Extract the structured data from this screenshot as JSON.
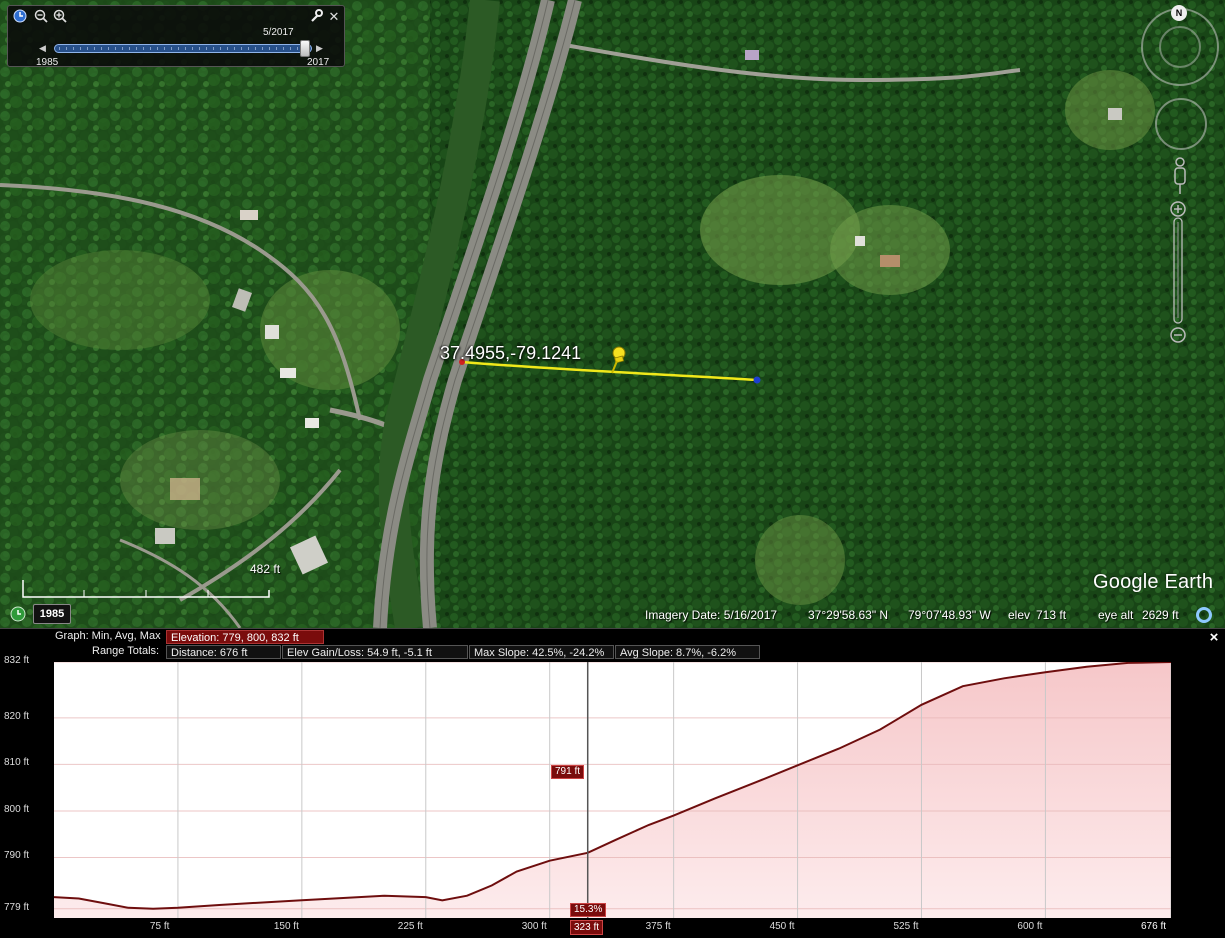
{
  "map": {
    "coord_label": "37.4955,-79.1241",
    "scale_label": "482 ft",
    "logo_text": "Google Earth",
    "imagery_year": "1985",
    "north_label": "N"
  },
  "time_slider": {
    "current_date": "5/2017",
    "start_year": "1985",
    "end_year": "2017",
    "position_fraction": 1.0
  },
  "status": {
    "imagery_date": "Imagery Date: 5/16/2017",
    "latitude": "37°29'58.63\" N",
    "longitude": "79°07'48.93\" W",
    "elev_label": "elev",
    "elev_value": "713 ft",
    "eye_alt_label": "eye alt",
    "eye_alt_value": "2629 ft"
  },
  "profile": {
    "graph_label": "Graph: Min, Avg, Max",
    "elevation_summary": "Elevation: 779, 800, 832 ft",
    "range_totals_label": "Range Totals:",
    "distance": "Distance: 676 ft",
    "elev_gain_loss": "Elev Gain/Loss: 54.9 ft, -5.1 ft",
    "max_slope": "Max Slope: 42.5%, -24.2%",
    "avg_slope": "Avg Slope: 8.7%, -6.2%",
    "cursor_elevation": "791 ft",
    "cursor_slope": "15.3%",
    "cursor_distance": "323 ft",
    "close_glyph": "×"
  },
  "chart_data": {
    "type": "area",
    "y_tick_labels": [
      "832 ft",
      "820 ft",
      "810 ft",
      "800 ft",
      "790 ft",
      "779 ft"
    ],
    "y_ticks": [
      832,
      820,
      810,
      800,
      790,
      779
    ],
    "x_tick_labels": [
      "75 ft",
      "150 ft",
      "225 ft",
      "300 ft",
      "375 ft",
      "450 ft",
      "525 ft",
      "600 ft",
      "676 ft"
    ],
    "x_ticks": [
      75,
      150,
      225,
      300,
      375,
      450,
      525,
      600,
      676
    ],
    "xlim": [
      0,
      676
    ],
    "ylim": [
      777,
      832
    ],
    "cursor_x": 323,
    "series": [
      {
        "x": [
          0,
          15,
          30,
          45,
          60,
          75,
          100,
          125,
          150,
          175,
          200,
          225,
          235,
          250,
          265,
          280,
          300,
          323,
          340,
          360,
          375,
          400,
          425,
          450,
          475,
          500,
          525,
          550,
          575,
          600,
          625,
          650,
          676
        ],
        "y": [
          781.5,
          781.2,
          780.2,
          779.2,
          779.0,
          779.2,
          779.8,
          780.3,
          780.8,
          781.3,
          781.8,
          781.5,
          780.8,
          781.8,
          784.0,
          787.0,
          789.3,
          791.0,
          793.8,
          797.0,
          799.0,
          802.7,
          806.2,
          809.8,
          813.4,
          817.5,
          822.8,
          826.8,
          828.5,
          829.8,
          831.0,
          831.8,
          832.0
        ]
      }
    ]
  }
}
